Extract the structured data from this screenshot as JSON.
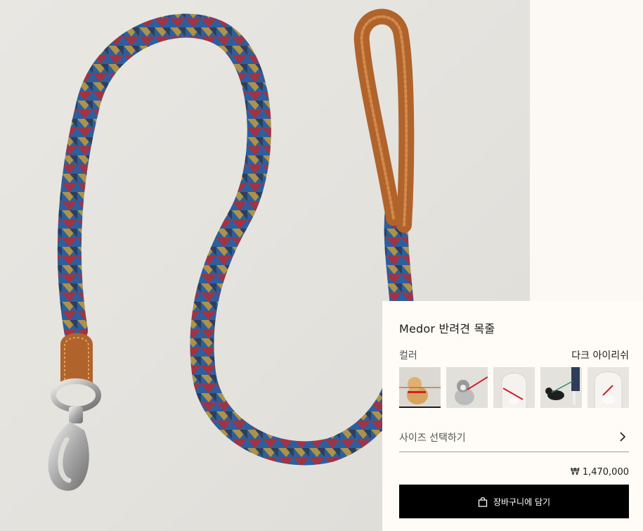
{
  "product": {
    "name": "Medor 반려견 목줄",
    "color_label": "컬러",
    "color_value": "다크 아이리쉬",
    "size_label": "사이즈 선택하기",
    "price": "₩ 1,470,000",
    "add_to_cart": "장바구니에 담기"
  },
  "thumbnails": [
    {
      "name": "pomeranian-with-leash",
      "selected": true
    },
    {
      "name": "husky-puppy-with-leash",
      "selected": false
    },
    {
      "name": "white-dog-arch-leash",
      "selected": false
    },
    {
      "name": "black-dog-walking",
      "selected": false
    },
    {
      "name": "white-dog-arch-closeup",
      "selected": false
    }
  ],
  "colors": {
    "leash_blue": "#2d5f9e",
    "leash_red": "#c8242a",
    "leash_yellow": "#d9a52d",
    "leash_navy": "#2f3448",
    "leather": "#b0642c",
    "button": "#000000"
  }
}
